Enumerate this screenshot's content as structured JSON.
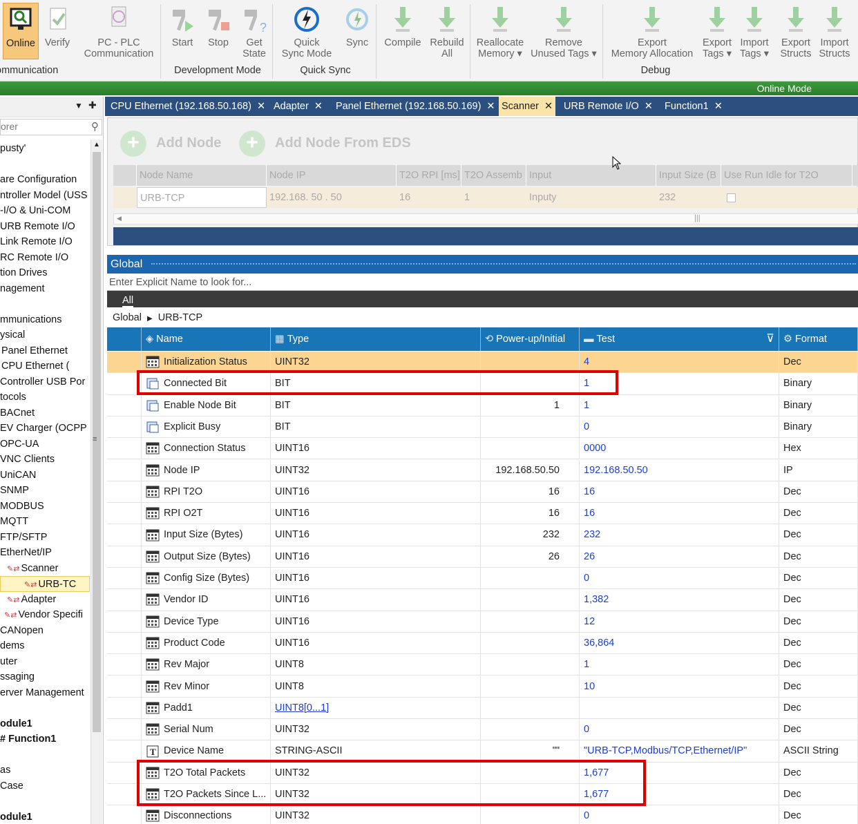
{
  "ribbon": {
    "buttons": [
      {
        "label": "Online",
        "icon": "online-monitor-icon"
      },
      {
        "label": "Verify",
        "icon": "verify-icon"
      },
      {
        "label": "PC - PLC\nCommunication",
        "icon": "pc-plc-icon"
      },
      {
        "label": "Start",
        "icon": "start-hammer-icon"
      },
      {
        "label": "Stop",
        "icon": "stop-hammer-icon"
      },
      {
        "label": "Get\nState",
        "icon": "get-state-icon"
      },
      {
        "label": "Quick\nSync Mode",
        "icon": "quick-sync-icon"
      },
      {
        "label": "Sync",
        "icon": "sync-icon"
      },
      {
        "label": "Compile",
        "icon": "compile-icon"
      },
      {
        "label": "Rebuild\nAll",
        "icon": "rebuild-icon"
      },
      {
        "label": "Reallocate\nMemory ▾",
        "icon": "reallocate-icon"
      },
      {
        "label": "Remove\nUnused Tags ▾",
        "icon": "remove-tags-icon"
      },
      {
        "label": "Export\nMemory Allocation",
        "icon": "export-memory-icon"
      },
      {
        "label": "Export\nTags ▾",
        "icon": "export-tags-icon"
      },
      {
        "label": "Import\nTags ▾",
        "icon": "import-tags-icon"
      },
      {
        "label": "Export\nStructs",
        "icon": "export-structs-icon"
      },
      {
        "label": "Import\nStructs",
        "icon": "import-structs-icon"
      }
    ],
    "groups": [
      "ommunication",
      "Development Mode",
      "Quick Sync",
      "Debug"
    ]
  },
  "status": {
    "mode": "Online Mode"
  },
  "left": {
    "search_placeholder": "orer",
    "items": [
      "pusty'",
      "",
      "are Configuration",
      "ntroller Model (USS",
      "-I/O & Uni-COM",
      "URB Remote I/O",
      "Link Remote I/O",
      "RC Remote I/O",
      "tion Drives",
      "nagement",
      "",
      "mmunications",
      "ysical",
      "Panel Ethernet",
      "CPU Ethernet (",
      "Controller USB Por",
      "tocols",
      "BACnet",
      "EV Charger (OCPP",
      "OPC-UA",
      "VNC Clients",
      "UniCAN",
      "SNMP",
      "MODBUS",
      "MQTT",
      "FTP/SFTP",
      "EtherNet/IP",
      "Scanner",
      "URB-TC",
      "Adapter",
      "Vendor Specifi",
      "CANopen",
      "dems",
      "uter",
      "ssaging",
      "erver Management",
      "",
      "odule1",
      "Function1",
      "",
      "as",
      "Case",
      "",
      "odule1"
    ]
  },
  "tabs": [
    {
      "label": "CPU Ethernet (192.168.50.168)"
    },
    {
      "label": "Adapter"
    },
    {
      "label": "Panel Ethernet (192.168.50.169)"
    },
    {
      "label": "Scanner"
    },
    {
      "label": "URB Remote I/O"
    },
    {
      "label": "Function1"
    }
  ],
  "tab_close": "✕",
  "node": {
    "add_node": "Add Node",
    "add_node_eds": "Add Node From EDS",
    "headers": [
      "Node Name",
      "Node IP",
      "T2O RPI [ms]",
      "T2O Assemb",
      "Input",
      "Input Size (B",
      "Use Run Idle for T2O"
    ],
    "row": [
      "URB-TCP",
      "192.168. 50 . 50",
      "16",
      "1",
      "Inputy",
      "232",
      ""
    ]
  },
  "global": {
    "title": "Global",
    "search_placeholder": "Enter Explicit Name to look for...",
    "filter_tab": "All",
    "breadcrumb": [
      "Global",
      "URB-TCP"
    ]
  },
  "grid": {
    "headers": [
      "Name",
      "Type",
      "Power-up/Initial",
      "Test",
      "Format"
    ],
    "rows": [
      {
        "name": "Initialization Status",
        "type": "UINT32",
        "init": "",
        "test": "4",
        "format": "Dec",
        "icon": "table-icon"
      },
      {
        "name": "Connected Bit",
        "type": "BIT",
        "init": "",
        "test": "1",
        "format": "Binary",
        "icon": "bit-icon"
      },
      {
        "name": "Enable Node Bit",
        "type": "BIT",
        "init": "1",
        "test": "1",
        "format": "Binary",
        "icon": "bit-icon"
      },
      {
        "name": "Explicit Busy",
        "type": "BIT",
        "init": "",
        "test": "0",
        "format": "Binary",
        "icon": "bit-icon"
      },
      {
        "name": "Connection Status",
        "type": "UINT16",
        "init": "",
        "test": "0000",
        "format": "Hex",
        "icon": "table-icon"
      },
      {
        "name": "Node IP",
        "type": "UINT32",
        "init": "192.168.50.50",
        "test": "192.168.50.50",
        "format": "IP",
        "icon": "table-icon"
      },
      {
        "name": "RPI T2O",
        "type": "UINT16",
        "init": "16",
        "test": "16",
        "format": "Dec",
        "icon": "table-icon"
      },
      {
        "name": "RPI O2T",
        "type": "UINT16",
        "init": "16",
        "test": "16",
        "format": "Dec",
        "icon": "table-icon"
      },
      {
        "name": "Input Size (Bytes)",
        "type": "UINT16",
        "init": "232",
        "test": "232",
        "format": "Dec",
        "icon": "table-icon"
      },
      {
        "name": "Output Size (Bytes)",
        "type": "UINT16",
        "init": "26",
        "test": "26",
        "format": "Dec",
        "icon": "table-icon"
      },
      {
        "name": "Config Size (Bytes)",
        "type": "UINT16",
        "init": "",
        "test": "0",
        "format": "Dec",
        "icon": "table-icon"
      },
      {
        "name": "Vendor ID",
        "type": "UINT16",
        "init": "",
        "test": "1,382",
        "format": "Dec",
        "icon": "table-icon"
      },
      {
        "name": "Device Type",
        "type": "UINT16",
        "init": "",
        "test": "12",
        "format": "Dec",
        "icon": "table-icon"
      },
      {
        "name": "Product Code",
        "type": "UINT16",
        "init": "",
        "test": "36,864",
        "format": "Dec",
        "icon": "table-icon"
      },
      {
        "name": "Rev Major",
        "type": "UINT8",
        "init": "",
        "test": "1",
        "format": "Dec",
        "icon": "table-icon"
      },
      {
        "name": "Rev Minor",
        "type": "UINT8",
        "init": "",
        "test": "10",
        "format": "Dec",
        "icon": "table-icon"
      },
      {
        "name": "Padd1",
        "type": "UINT8[0...1]",
        "init": "",
        "test": "",
        "format": "Dec",
        "icon": "table-icon",
        "type_link": true
      },
      {
        "name": "Serial Num",
        "type": "UINT32",
        "init": "",
        "test": "0",
        "format": "Dec",
        "icon": "table-icon"
      },
      {
        "name": "Device Name",
        "type": "STRING-ASCII",
        "init": "\"\"",
        "test": "\"URB-TCP,Modbus/TCP,Ethernet/IP\"",
        "format": "ASCII String",
        "icon": "text-icon"
      },
      {
        "name": "T2O Total Packets",
        "type": "UINT32",
        "init": "",
        "test": "1,677",
        "format": "Dec",
        "icon": "table-icon"
      },
      {
        "name": "T2O Packets Since L...",
        "type": "UINT32",
        "init": "",
        "test": "1,677",
        "format": "Dec",
        "icon": "table-icon"
      },
      {
        "name": "Disconnections",
        "type": "UINT32",
        "init": "",
        "test": "0",
        "format": "Dec",
        "icon": "table-icon"
      }
    ]
  },
  "colors": {
    "accent": "#1876b8",
    "tab_bar": "#2b4f7e",
    "online": "#2a7d2a",
    "highlight": "#e00000",
    "selected_row": "#fcd690"
  }
}
